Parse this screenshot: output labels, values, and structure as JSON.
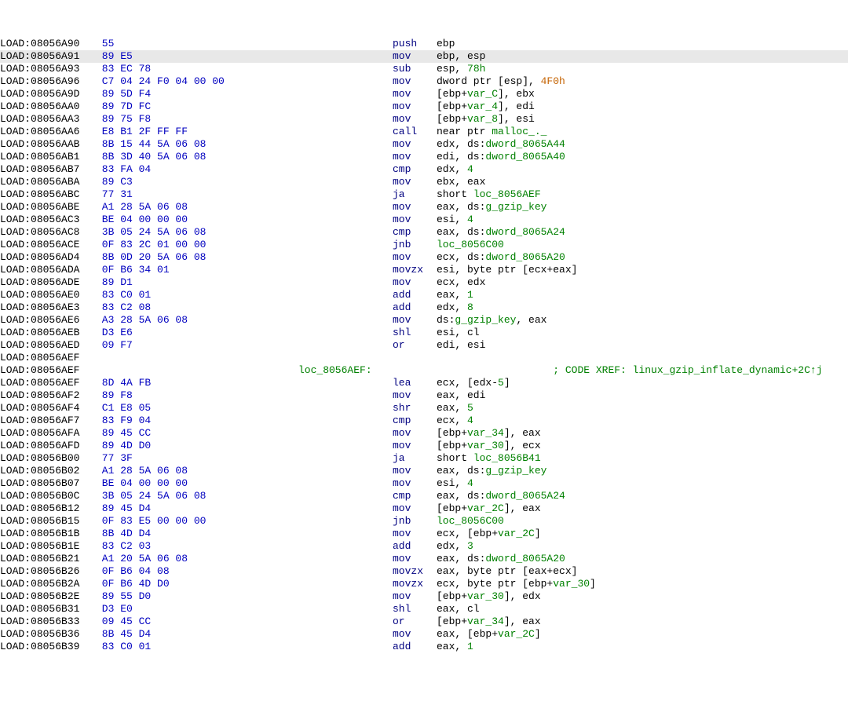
{
  "segment_prefix": "LOAD:",
  "lines": [
    {
      "addr": "08056A90",
      "bytes": "55",
      "mnem": "push",
      "ops": [
        {
          "t": "plain",
          "v": "ebp"
        }
      ],
      "sel": false
    },
    {
      "addr": "08056A91",
      "bytes": "89 E5",
      "mnem": "mov",
      "ops": [
        {
          "t": "plain",
          "v": "ebp, esp"
        }
      ],
      "sel": true
    },
    {
      "addr": "08056A93",
      "bytes": "83 EC 78",
      "mnem": "sub",
      "ops": [
        {
          "t": "plain",
          "v": "esp, "
        },
        {
          "t": "num-green",
          "v": "78h"
        }
      ],
      "sel": false
    },
    {
      "addr": "08056A96",
      "bytes": "C7 04 24 F0 04 00 00",
      "mnem": "mov",
      "ops": [
        {
          "t": "plain",
          "v": "dword ptr [esp], "
        },
        {
          "t": "orange",
          "v": "4F0h"
        }
      ],
      "sel": false
    },
    {
      "addr": "08056A9D",
      "bytes": "89 5D F4",
      "mnem": "mov",
      "ops": [
        {
          "t": "plain",
          "v": "[ebp+"
        },
        {
          "t": "name-green",
          "v": "var_C"
        },
        {
          "t": "plain",
          "v": "], ebx"
        }
      ],
      "sel": false
    },
    {
      "addr": "08056AA0",
      "bytes": "89 7D FC",
      "mnem": "mov",
      "ops": [
        {
          "t": "plain",
          "v": "[ebp+"
        },
        {
          "t": "name-green",
          "v": "var_4"
        },
        {
          "t": "plain",
          "v": "], edi"
        }
      ],
      "sel": false
    },
    {
      "addr": "08056AA3",
      "bytes": "89 75 F8",
      "mnem": "mov",
      "ops": [
        {
          "t": "plain",
          "v": "[ebp+"
        },
        {
          "t": "name-green",
          "v": "var_8"
        },
        {
          "t": "plain",
          "v": "], esi"
        }
      ],
      "sel": false
    },
    {
      "addr": "08056AA6",
      "bytes": "E8 B1 2F FF FF",
      "mnem": "call",
      "ops": [
        {
          "t": "plain",
          "v": "near ptr "
        },
        {
          "t": "name-green",
          "v": "malloc_._"
        }
      ],
      "sel": false
    },
    {
      "addr": "08056AAB",
      "bytes": "8B 15 44 5A 06 08",
      "mnem": "mov",
      "ops": [
        {
          "t": "plain",
          "v": "edx, ds:"
        },
        {
          "t": "name-green",
          "v": "dword_8065A44"
        }
      ],
      "sel": false
    },
    {
      "addr": "08056AB1",
      "bytes": "8B 3D 40 5A 06 08",
      "mnem": "mov",
      "ops": [
        {
          "t": "plain",
          "v": "edi, ds:"
        },
        {
          "t": "name-green",
          "v": "dword_8065A40"
        }
      ],
      "sel": false
    },
    {
      "addr": "08056AB7",
      "bytes": "83 FA 04",
      "mnem": "cmp",
      "ops": [
        {
          "t": "plain",
          "v": "edx, "
        },
        {
          "t": "num-green",
          "v": "4"
        }
      ],
      "sel": false
    },
    {
      "addr": "08056ABA",
      "bytes": "89 C3",
      "mnem": "mov",
      "ops": [
        {
          "t": "plain",
          "v": "ebx, eax"
        }
      ],
      "sel": false
    },
    {
      "addr": "08056ABC",
      "bytes": "77 31",
      "mnem": "ja",
      "ops": [
        {
          "t": "plain",
          "v": "short "
        },
        {
          "t": "name-green",
          "v": "loc_8056AEF"
        }
      ],
      "sel": false
    },
    {
      "addr": "08056ABE",
      "bytes": "A1 28 5A 06 08",
      "mnem": "mov",
      "ops": [
        {
          "t": "plain",
          "v": "eax, ds:"
        },
        {
          "t": "name-green",
          "v": "g_gzip_key"
        }
      ],
      "sel": false
    },
    {
      "addr": "08056AC3",
      "bytes": "BE 04 00 00 00",
      "mnem": "mov",
      "ops": [
        {
          "t": "plain",
          "v": "esi, "
        },
        {
          "t": "num-green",
          "v": "4"
        }
      ],
      "sel": false
    },
    {
      "addr": "08056AC8",
      "bytes": "3B 05 24 5A 06 08",
      "mnem": "cmp",
      "ops": [
        {
          "t": "plain",
          "v": "eax, ds:"
        },
        {
          "t": "name-green",
          "v": "dword_8065A24"
        }
      ],
      "sel": false
    },
    {
      "addr": "08056ACE",
      "bytes": "0F 83 2C 01 00 00",
      "mnem": "jnb",
      "ops": [
        {
          "t": "name-green",
          "v": "loc_8056C00"
        }
      ],
      "sel": false
    },
    {
      "addr": "08056AD4",
      "bytes": "8B 0D 20 5A 06 08",
      "mnem": "mov",
      "ops": [
        {
          "t": "plain",
          "v": "ecx, ds:"
        },
        {
          "t": "name-green",
          "v": "dword_8065A20"
        }
      ],
      "sel": false
    },
    {
      "addr": "08056ADA",
      "bytes": "0F B6 34 01",
      "mnem": "movzx",
      "ops": [
        {
          "t": "plain",
          "v": "esi, byte ptr [ecx+eax]"
        }
      ],
      "sel": false
    },
    {
      "addr": "08056ADE",
      "bytes": "89 D1",
      "mnem": "mov",
      "ops": [
        {
          "t": "plain",
          "v": "ecx, edx"
        }
      ],
      "sel": false
    },
    {
      "addr": "08056AE0",
      "bytes": "83 C0 01",
      "mnem": "add",
      "ops": [
        {
          "t": "plain",
          "v": "eax, "
        },
        {
          "t": "num-green",
          "v": "1"
        }
      ],
      "sel": false
    },
    {
      "addr": "08056AE3",
      "bytes": "83 C2 08",
      "mnem": "add",
      "ops": [
        {
          "t": "plain",
          "v": "edx, "
        },
        {
          "t": "num-green",
          "v": "8"
        }
      ],
      "sel": false
    },
    {
      "addr": "08056AE6",
      "bytes": "A3 28 5A 06 08",
      "mnem": "mov",
      "ops": [
        {
          "t": "plain",
          "v": "ds:"
        },
        {
          "t": "name-green",
          "v": "g_gzip_key"
        },
        {
          "t": "plain",
          "v": ", eax"
        }
      ],
      "sel": false
    },
    {
      "addr": "08056AEB",
      "bytes": "D3 E6",
      "mnem": "shl",
      "ops": [
        {
          "t": "plain",
          "v": "esi, cl"
        }
      ],
      "sel": false
    },
    {
      "addr": "08056AED",
      "bytes": "09 F7",
      "mnem": "or",
      "ops": [
        {
          "t": "plain",
          "v": "edi, esi"
        }
      ],
      "sel": false
    },
    {
      "addr": "08056AEF",
      "bytes": "",
      "mnem": "",
      "ops": [],
      "sel": false,
      "blank": true
    },
    {
      "addr": "08056AEF",
      "bytes": "",
      "mnem": "",
      "loc": "loc_8056AEF:",
      "ops": [],
      "xref": "; CODE XREF: linux_gzip_inflate_dynamic+2C↑j",
      "sel": false
    },
    {
      "addr": "08056AEF",
      "bytes": "8D 4A FB",
      "mnem": "lea",
      "ops": [
        {
          "t": "plain",
          "v": "ecx, [edx-"
        },
        {
          "t": "num-green",
          "v": "5"
        },
        {
          "t": "plain",
          "v": "]"
        }
      ],
      "sel": false
    },
    {
      "addr": "08056AF2",
      "bytes": "89 F8",
      "mnem": "mov",
      "ops": [
        {
          "t": "plain",
          "v": "eax, edi"
        }
      ],
      "sel": false
    },
    {
      "addr": "08056AF4",
      "bytes": "C1 E8 05",
      "mnem": "shr",
      "ops": [
        {
          "t": "plain",
          "v": "eax, "
        },
        {
          "t": "num-green",
          "v": "5"
        }
      ],
      "sel": false
    },
    {
      "addr": "08056AF7",
      "bytes": "83 F9 04",
      "mnem": "cmp",
      "ops": [
        {
          "t": "plain",
          "v": "ecx, "
        },
        {
          "t": "num-green",
          "v": "4"
        }
      ],
      "sel": false
    },
    {
      "addr": "08056AFA",
      "bytes": "89 45 CC",
      "mnem": "mov",
      "ops": [
        {
          "t": "plain",
          "v": "[ebp+"
        },
        {
          "t": "name-green",
          "v": "var_34"
        },
        {
          "t": "plain",
          "v": "], eax"
        }
      ],
      "sel": false
    },
    {
      "addr": "08056AFD",
      "bytes": "89 4D D0",
      "mnem": "mov",
      "ops": [
        {
          "t": "plain",
          "v": "[ebp+"
        },
        {
          "t": "name-green",
          "v": "var_30"
        },
        {
          "t": "plain",
          "v": "], ecx"
        }
      ],
      "sel": false
    },
    {
      "addr": "08056B00",
      "bytes": "77 3F",
      "mnem": "ja",
      "ops": [
        {
          "t": "plain",
          "v": "short "
        },
        {
          "t": "name-green",
          "v": "loc_8056B41"
        }
      ],
      "sel": false
    },
    {
      "addr": "08056B02",
      "bytes": "A1 28 5A 06 08",
      "mnem": "mov",
      "ops": [
        {
          "t": "plain",
          "v": "eax, ds:"
        },
        {
          "t": "name-green",
          "v": "g_gzip_key"
        }
      ],
      "sel": false
    },
    {
      "addr": "08056B07",
      "bytes": "BE 04 00 00 00",
      "mnem": "mov",
      "ops": [
        {
          "t": "plain",
          "v": "esi, "
        },
        {
          "t": "num-green",
          "v": "4"
        }
      ],
      "sel": false
    },
    {
      "addr": "08056B0C",
      "bytes": "3B 05 24 5A 06 08",
      "mnem": "cmp",
      "ops": [
        {
          "t": "plain",
          "v": "eax, ds:"
        },
        {
          "t": "name-green",
          "v": "dword_8065A24"
        }
      ],
      "sel": false
    },
    {
      "addr": "08056B12",
      "bytes": "89 45 D4",
      "mnem": "mov",
      "ops": [
        {
          "t": "plain",
          "v": "[ebp+"
        },
        {
          "t": "name-green",
          "v": "var_2C"
        },
        {
          "t": "plain",
          "v": "], eax"
        }
      ],
      "sel": false
    },
    {
      "addr": "08056B15",
      "bytes": "0F 83 E5 00 00 00",
      "mnem": "jnb",
      "ops": [
        {
          "t": "name-green",
          "v": "loc_8056C00"
        }
      ],
      "sel": false
    },
    {
      "addr": "08056B1B",
      "bytes": "8B 4D D4",
      "mnem": "mov",
      "ops": [
        {
          "t": "plain",
          "v": "ecx, [ebp+"
        },
        {
          "t": "name-green",
          "v": "var_2C"
        },
        {
          "t": "plain",
          "v": "]"
        }
      ],
      "sel": false
    },
    {
      "addr": "08056B1E",
      "bytes": "83 C2 03",
      "mnem": "add",
      "ops": [
        {
          "t": "plain",
          "v": "edx, "
        },
        {
          "t": "num-green",
          "v": "3"
        }
      ],
      "sel": false
    },
    {
      "addr": "08056B21",
      "bytes": "A1 20 5A 06 08",
      "mnem": "mov",
      "ops": [
        {
          "t": "plain",
          "v": "eax, ds:"
        },
        {
          "t": "name-green",
          "v": "dword_8065A20"
        }
      ],
      "sel": false
    },
    {
      "addr": "08056B26",
      "bytes": "0F B6 04 08",
      "mnem": "movzx",
      "ops": [
        {
          "t": "plain",
          "v": "eax, byte ptr [eax+ecx]"
        }
      ],
      "sel": false
    },
    {
      "addr": "08056B2A",
      "bytes": "0F B6 4D D0",
      "mnem": "movzx",
      "ops": [
        {
          "t": "plain",
          "v": "ecx, byte ptr [ebp+"
        },
        {
          "t": "name-green",
          "v": "var_30"
        },
        {
          "t": "plain",
          "v": "]"
        }
      ],
      "sel": false
    },
    {
      "addr": "08056B2E",
      "bytes": "89 55 D0",
      "mnem": "mov",
      "ops": [
        {
          "t": "plain",
          "v": "[ebp+"
        },
        {
          "t": "name-green",
          "v": "var_30"
        },
        {
          "t": "plain",
          "v": "], edx"
        }
      ],
      "sel": false
    },
    {
      "addr": "08056B31",
      "bytes": "D3 E0",
      "mnem": "shl",
      "ops": [
        {
          "t": "plain",
          "v": "eax, cl"
        }
      ],
      "sel": false
    },
    {
      "addr": "08056B33",
      "bytes": "09 45 CC",
      "mnem": "or",
      "ops": [
        {
          "t": "plain",
          "v": "[ebp+"
        },
        {
          "t": "name-green",
          "v": "var_34"
        },
        {
          "t": "plain",
          "v": "], eax"
        }
      ],
      "sel": false
    },
    {
      "addr": "08056B36",
      "bytes": "8B 45 D4",
      "mnem": "mov",
      "ops": [
        {
          "t": "plain",
          "v": "eax, [ebp+"
        },
        {
          "t": "name-green",
          "v": "var_2C"
        },
        {
          "t": "plain",
          "v": "]"
        }
      ],
      "sel": false
    },
    {
      "addr": "08056B39",
      "bytes": "83 C0 01",
      "mnem": "add",
      "ops": [
        {
          "t": "plain",
          "v": "eax, "
        },
        {
          "t": "num-green",
          "v": "1"
        }
      ],
      "sel": false
    }
  ]
}
